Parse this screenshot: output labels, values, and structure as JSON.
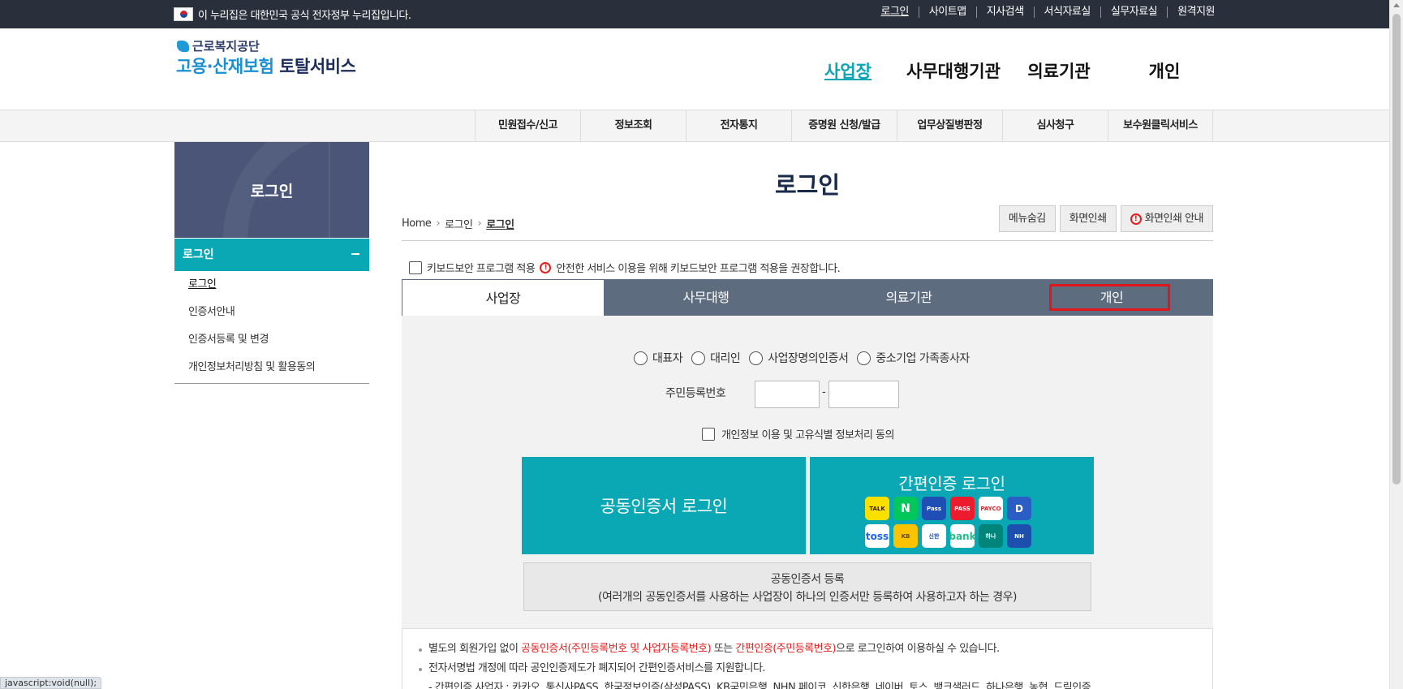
{
  "topbar": {
    "gov_notice": "이 누리집은 대한민국 공식 전자정부 누리집입니다.",
    "links": [
      "로그인",
      "사이트맵",
      "지사검색",
      "서식자료실",
      "실무자료실",
      "원격지원"
    ]
  },
  "header": {
    "logo_small": "근로복지공단",
    "logo_blue": "고용·산재보험",
    "logo_dark": "토탈서비스",
    "gnb": [
      "사업장",
      "사무대행기관",
      "의료기관",
      "개인"
    ]
  },
  "subnav": [
    "민원접수/신고",
    "정보조회",
    "전자통지",
    "증명원 신청/발급",
    "업무상질병판정",
    "심사청구",
    "보수원클릭서비스"
  ],
  "sidebar": {
    "title": "로그인",
    "category": "로그인",
    "items": [
      "로그인",
      "인증서안내",
      "인증서등록 및 변경",
      "개인정보처리방침 및 활용동의"
    ]
  },
  "content": {
    "title": "로그인",
    "breadcrumb": [
      "Home",
      "로그인",
      "로그인"
    ],
    "util_buttons": {
      "hide_menu": "메뉴숨김",
      "print": "화면인쇄",
      "print_guide": "화면인쇄 안내"
    },
    "keyboard": {
      "label": "키보드보안 프로그램 적용",
      "notice": "안전한 서비스 이용을 위해 키보드보안 프로그램 적용을 권장합니다."
    },
    "tabs": [
      "사업장",
      "사무대행",
      "의료기관",
      "개인"
    ],
    "radios": [
      "대표자",
      "대리인",
      "사업장명의인증서",
      "중소기업 가족종사자"
    ],
    "ssn_label": "주민등록번호",
    "ssn_dash": "-",
    "consent": "개인정보 이용 및 고유식별 정보처리 동의",
    "cert_login": "공동인증서 로그인",
    "simple_login": "간편인증 로그인",
    "simple_icons": [
      "TALK",
      "N",
      "Pass",
      "PASS",
      "PAYCO",
      "D",
      "toss",
      "KB",
      "신한",
      "bank",
      "하나",
      "NH"
    ],
    "register_line1": "공동인증서 등록",
    "register_line2": "(여러개의 공동인증서를 사용하는 사업장이 하나의 인증서만 등록하여 사용하고자 하는 경우)",
    "notice": {
      "l1_a": "별도의 회원가입 없이 ",
      "l1_b": "공동인증서(주민등록번호 및 사업자등록번호)",
      "l1_c": " 또는 ",
      "l1_d": "간편인증(주민등록번호)",
      "l1_e": "으로 로그인하여 이용하실 수 있습니다.",
      "l2": "전자서명법 개정에 따라 공인인증제도가 폐지되어 간편인증서비스를 지원합니다.",
      "l3": "- 간편인증 사업자 : 카카오, 통신사PASS, 한국정보인증(삼성PASS), KB국민은행, NHN 페이코, 신한은행, 네이버, 토스, 뱅크샐러드, 하나은행, 농협, 드림인증"
    }
  },
  "status_bar": "javascript:void(null);",
  "colors": {
    "topbar": "#2a2f3c",
    "teal": "#0aa8b4",
    "tab_bar": "#5e6c80",
    "sidebar_head": "#4a5577",
    "highlight": "#e0161b"
  }
}
